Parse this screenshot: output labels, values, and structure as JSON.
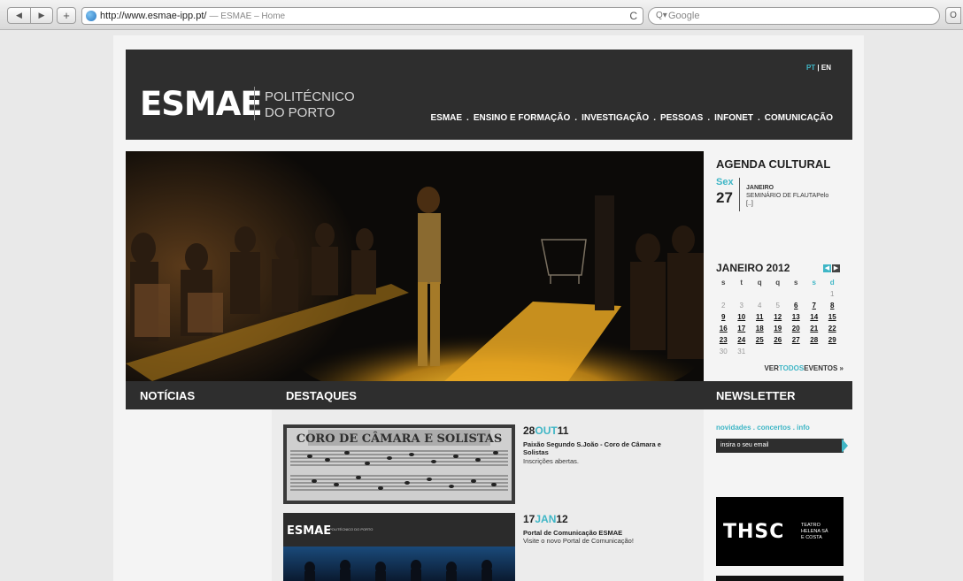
{
  "browser": {
    "back_label": "◀",
    "forward_label": "▶",
    "new_tab_label": "+",
    "url": "http://www.esmae-ipp.pt/",
    "page_title": "— ESMAE – Home",
    "reload_glyph": "C",
    "search_placeholder": "Google",
    "search_glyph": "Q▾",
    "extra_button": "O"
  },
  "header": {
    "logo": "ESMAE",
    "logo_sub_1": "POLITÉCNICO",
    "logo_sub_2": "DO PORTO",
    "lang_pt": "PT",
    "lang_sep": " | ",
    "lang_en": "EN",
    "nav": [
      "ESMAE",
      "ENSINO E FORMAÇÃO",
      "INVESTIGAÇÃO",
      "PESSOAS",
      "INFONET",
      "COMUNICAÇÃO"
    ],
    "nav_sep": "."
  },
  "agenda": {
    "title": "AGENDA CULTURAL",
    "day_name": "Sex",
    "day_num": "27",
    "month": "JANEIRO",
    "event": "SEMINÁRIO DE FLAUTAPelo [..]"
  },
  "calendar": {
    "title": "JANEIRO 2012",
    "prev_glyph": "◀",
    "next_glyph": "▶",
    "weekdays": [
      "s",
      "t",
      "q",
      "q",
      "s",
      "s",
      "d"
    ],
    "weeks": [
      [
        "",
        "",
        "",
        "",
        "",
        "",
        "1"
      ],
      [
        "2",
        "3",
        "4",
        "5",
        "6",
        "7",
        "8"
      ],
      [
        "9",
        "10",
        "11",
        "12",
        "13",
        "14",
        "15"
      ],
      [
        "16",
        "17",
        "18",
        "19",
        "20",
        "21",
        "22"
      ],
      [
        "23",
        "24",
        "25",
        "26",
        "27",
        "28",
        "29"
      ],
      [
        "30",
        "31",
        "",
        "",
        "",
        "",
        ""
      ]
    ],
    "ver": "VER",
    "todos": "TODOS",
    "eventos": "EVENTOS »"
  },
  "sections": {
    "noticias": "NOTÍCIAS",
    "destaques": "DESTAQUES",
    "newsletter": "NEWSLETTER"
  },
  "destaques": [
    {
      "day": "28",
      "month": "OUT",
      "year": "11",
      "title": "Paixão Segundo S.João - Coro de Câmara e Solistas",
      "desc": "Inscrições abertas.",
      "thumb_text": "CORO DE CÂMARA E SOLISTAS"
    },
    {
      "day": "17",
      "month": "JAN",
      "year": "12",
      "title": "Portal de Comunicação ESMAE",
      "desc": "Visite o novo Portal de Comunicação!",
      "thumb_logo": "ESMAE",
      "thumb_sub": "POLITÉCNICO DO PORTO"
    }
  ],
  "newsletter": {
    "links": [
      "novidades",
      "concertos",
      "info"
    ],
    "link_sep": " . ",
    "input_placeholder": "insira o seu email"
  },
  "sponsor": {
    "logo": "THSC",
    "line1": "TEATRO",
    "line2": "HELENA SÁ",
    "line3": "E COSTA"
  },
  "colors": {
    "accent": "#3fb6c6",
    "header_bg": "#2e2e2e"
  }
}
